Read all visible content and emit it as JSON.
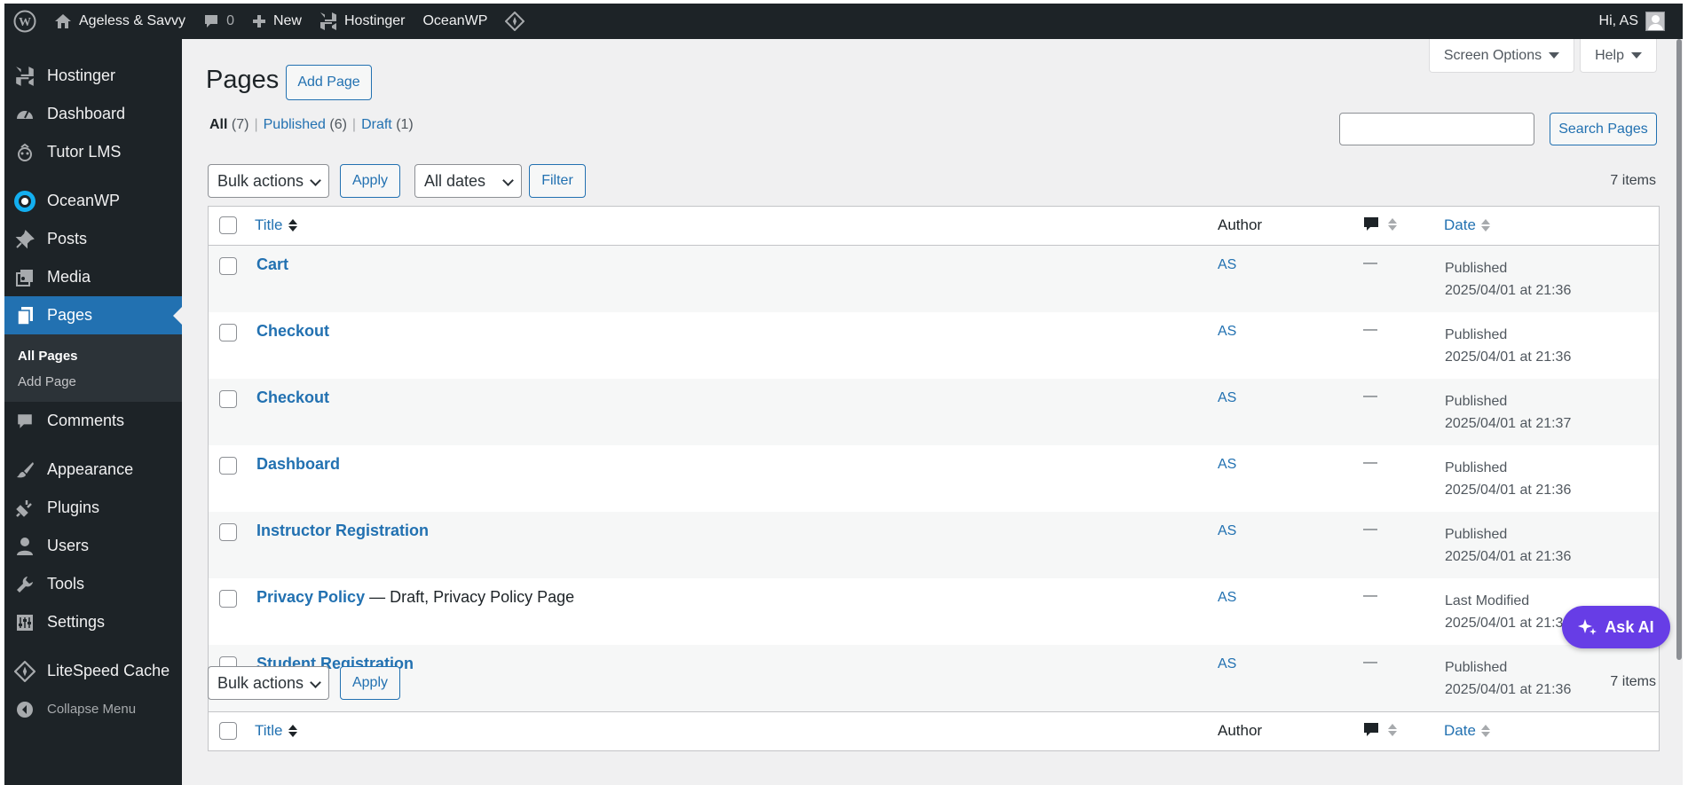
{
  "adminbar": {
    "site_name": "Ageless & Savvy",
    "comments_count": "0",
    "new_label": "New",
    "hostinger_label": "Hostinger",
    "oceanwp_label": "OceanWP",
    "greeting": "Hi, AS"
  },
  "sidebar": {
    "items": [
      {
        "label": "Hostinger",
        "icon": "hostinger-icon"
      },
      {
        "label": "Dashboard",
        "icon": "dashboard-icon"
      },
      {
        "label": "Tutor LMS",
        "icon": "tutor-icon"
      },
      {
        "label": "OceanWP",
        "icon": "oceanwp-icon"
      },
      {
        "label": "Posts",
        "icon": "pin-icon"
      },
      {
        "label": "Media",
        "icon": "media-icon"
      },
      {
        "label": "Pages",
        "icon": "pages-icon"
      },
      {
        "label": "Comments",
        "icon": "comments-icon"
      },
      {
        "label": "Appearance",
        "icon": "brush-icon"
      },
      {
        "label": "Plugins",
        "icon": "plugin-icon"
      },
      {
        "label": "Users",
        "icon": "user-icon"
      },
      {
        "label": "Tools",
        "icon": "wrench-icon"
      },
      {
        "label": "Settings",
        "icon": "settings-icon"
      },
      {
        "label": "LiteSpeed Cache",
        "icon": "litespeed-icon"
      }
    ],
    "submenu": [
      "All Pages",
      "Add Page"
    ],
    "collapse_label": "Collapse Menu"
  },
  "header": {
    "screen_options": "Screen Options",
    "help": "Help",
    "title": "Pages",
    "add_page": "Add Page"
  },
  "filters": {
    "all_label": "All",
    "all_count": "(7)",
    "published_label": "Published",
    "published_count": "(6)",
    "draft_label": "Draft",
    "draft_count": "(1)",
    "search_button": "Search Pages",
    "search_value": "",
    "bulk_actions": "Bulk actions",
    "apply": "Apply",
    "all_dates": "All dates",
    "filter": "Filter",
    "items_count": "7 items"
  },
  "table": {
    "columns": {
      "title": "Title",
      "author": "Author",
      "date": "Date"
    },
    "rows": [
      {
        "title": "Cart",
        "state": "",
        "author": "AS",
        "comments": "—",
        "status": "Published",
        "date": "2025/04/01 at 21:36"
      },
      {
        "title": "Checkout",
        "state": "",
        "author": "AS",
        "comments": "—",
        "status": "Published",
        "date": "2025/04/01 at 21:36"
      },
      {
        "title": "Checkout",
        "state": "",
        "author": "AS",
        "comments": "—",
        "status": "Published",
        "date": "2025/04/01 at 21:37"
      },
      {
        "title": "Dashboard",
        "state": "",
        "author": "AS",
        "comments": "—",
        "status": "Published",
        "date": "2025/04/01 at 21:36"
      },
      {
        "title": "Instructor Registration",
        "state": "",
        "author": "AS",
        "comments": "—",
        "status": "Published",
        "date": "2025/04/01 at 21:36"
      },
      {
        "title": "Privacy Policy",
        "state": " — Draft, Privacy Policy Page",
        "author": "AS",
        "comments": "—",
        "status": "Last Modified",
        "date": "2025/04/01 at 21:32"
      },
      {
        "title": "Student Registration",
        "state": "",
        "author": "AS",
        "comments": "—",
        "status": "Published",
        "date": "2025/04/01 at 21:36"
      }
    ]
  },
  "ask_ai": "Ask AI",
  "colors": {
    "accent": "#2271b1",
    "adminbar": "#1d2327",
    "ask_ai": "#673de6"
  }
}
